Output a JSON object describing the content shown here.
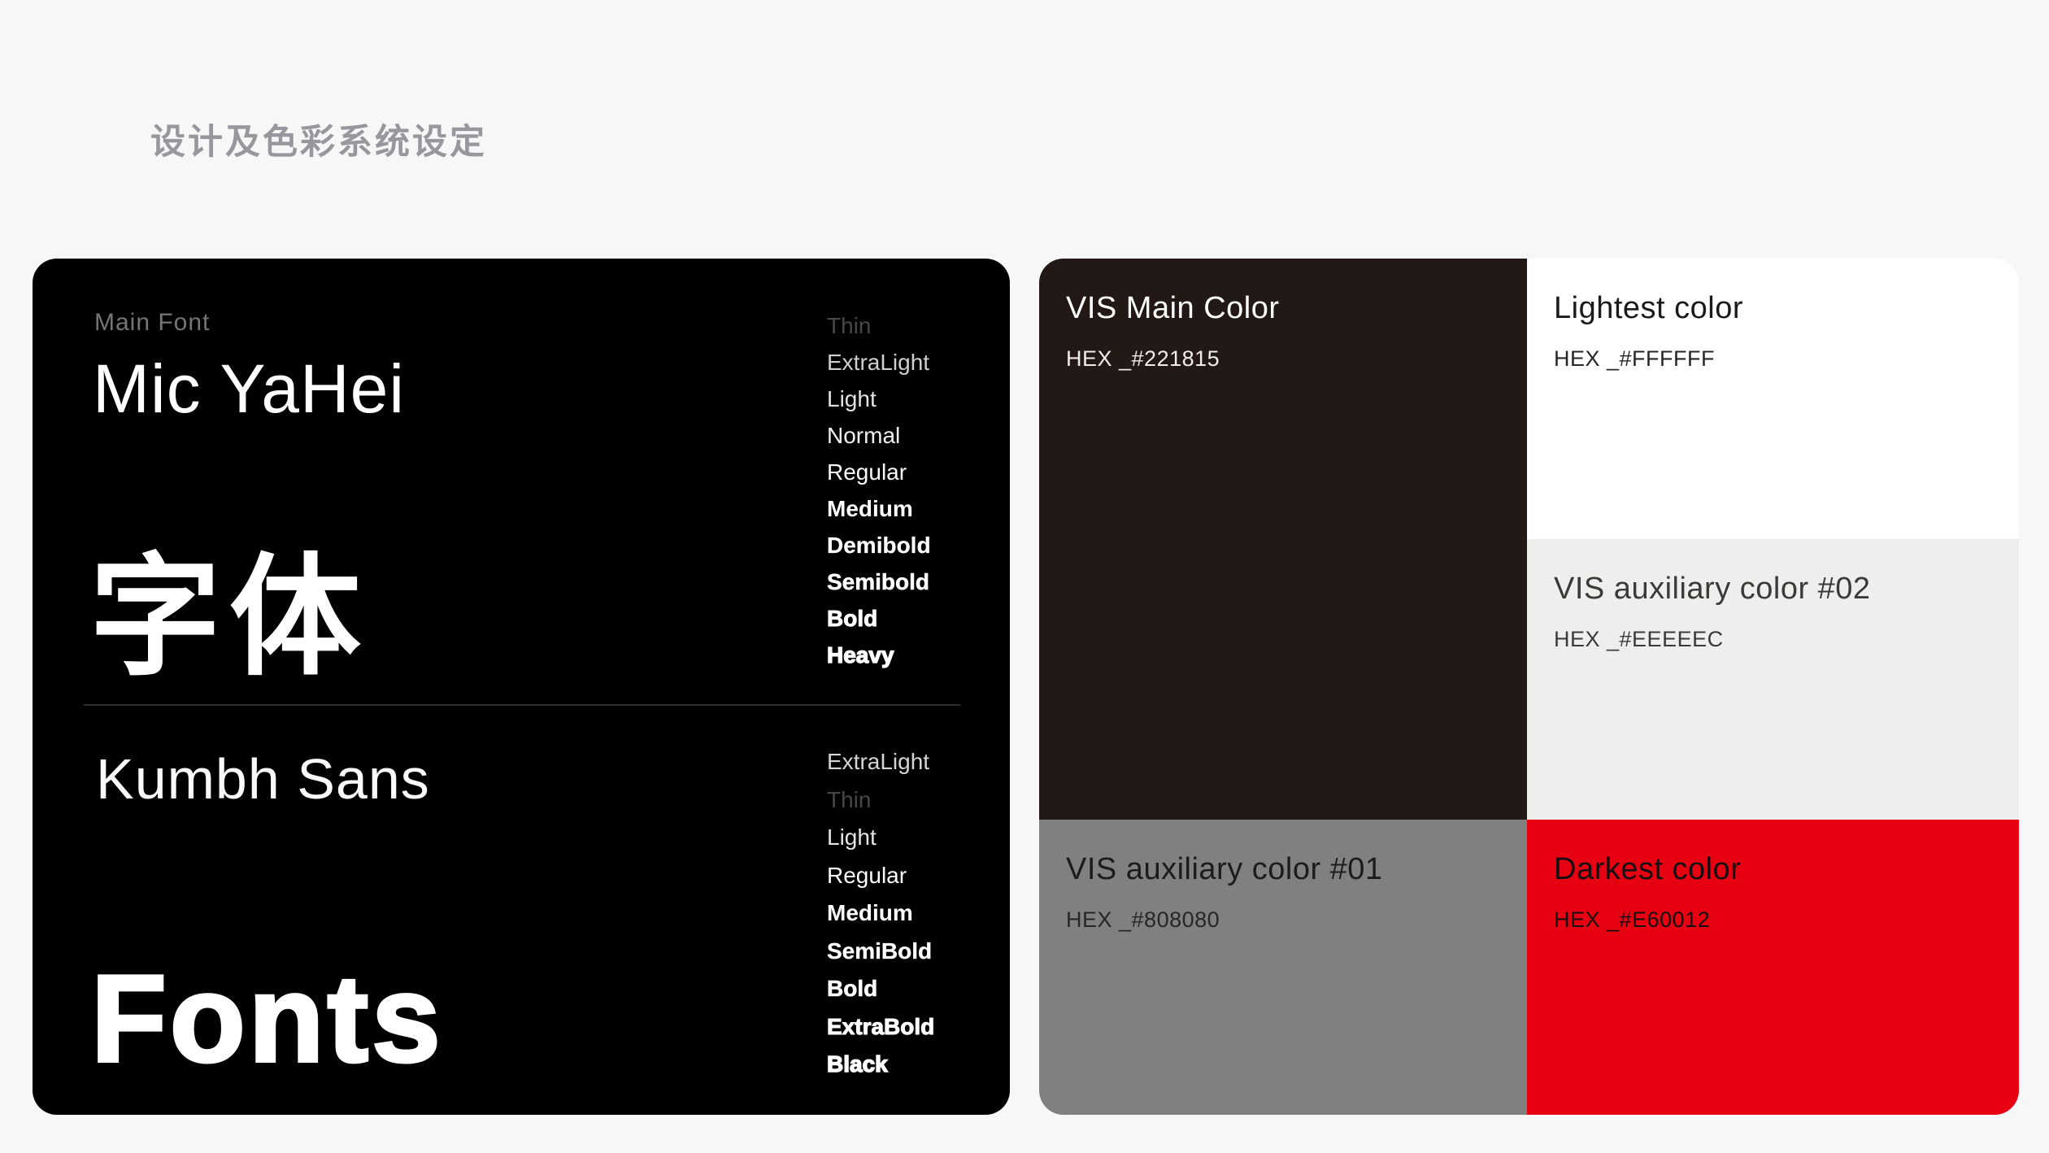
{
  "page": {
    "title": "设计及色彩系统设定"
  },
  "fonts_card": {
    "main_font_label": "Main Font",
    "main_font_name": "Mic YaHei",
    "main_font_cjk": "字体",
    "secondary_font_name": "Kumbh Sans",
    "secondary_font_display": "Fonts",
    "main_weights": [
      "Thin",
      "ExtraLight",
      "Light",
      "Normal",
      "Regular",
      "Medium",
      "Demibold",
      "Semibold",
      "Bold",
      "Heavy"
    ],
    "secondary_weights": [
      "ExtraLight",
      "Thin",
      "Light",
      "Regular",
      "Medium",
      "SemiBold",
      "Bold",
      "ExtraBold",
      "Black"
    ]
  },
  "colors_card": {
    "swatches": {
      "main": {
        "name": "VIS Main Color",
        "hex_label": "HEX _#221815",
        "hex": "#221815",
        "text_color": "#FFFFFF",
        "hex_text_color": "#EFEDEB"
      },
      "lightest": {
        "name": "Lightest color",
        "hex_label": "HEX _#FFFFFF",
        "hex": "#FFFFFF",
        "text_color": "#1A1A1A",
        "hex_text_color": "#262626"
      },
      "aux2": {
        "name": "VIS auxiliary color #02",
        "hex_label": "HEX _#EEEEEC",
        "hex": "#EEEEEC",
        "text_color": "#3B3A37",
        "hex_text_color": "#3B3A37"
      },
      "aux1": {
        "name": "VIS auxiliary color #01",
        "hex_label": "HEX _#808080",
        "hex": "#808080",
        "text_color": "#1C1C1C",
        "hex_text_color": "#262626"
      },
      "darkest": {
        "name": "Darkest color",
        "hex_label": "HEX _#E60012",
        "hex": "#E60012",
        "text_color": "#141011",
        "hex_text_color": "#141011"
      }
    }
  }
}
